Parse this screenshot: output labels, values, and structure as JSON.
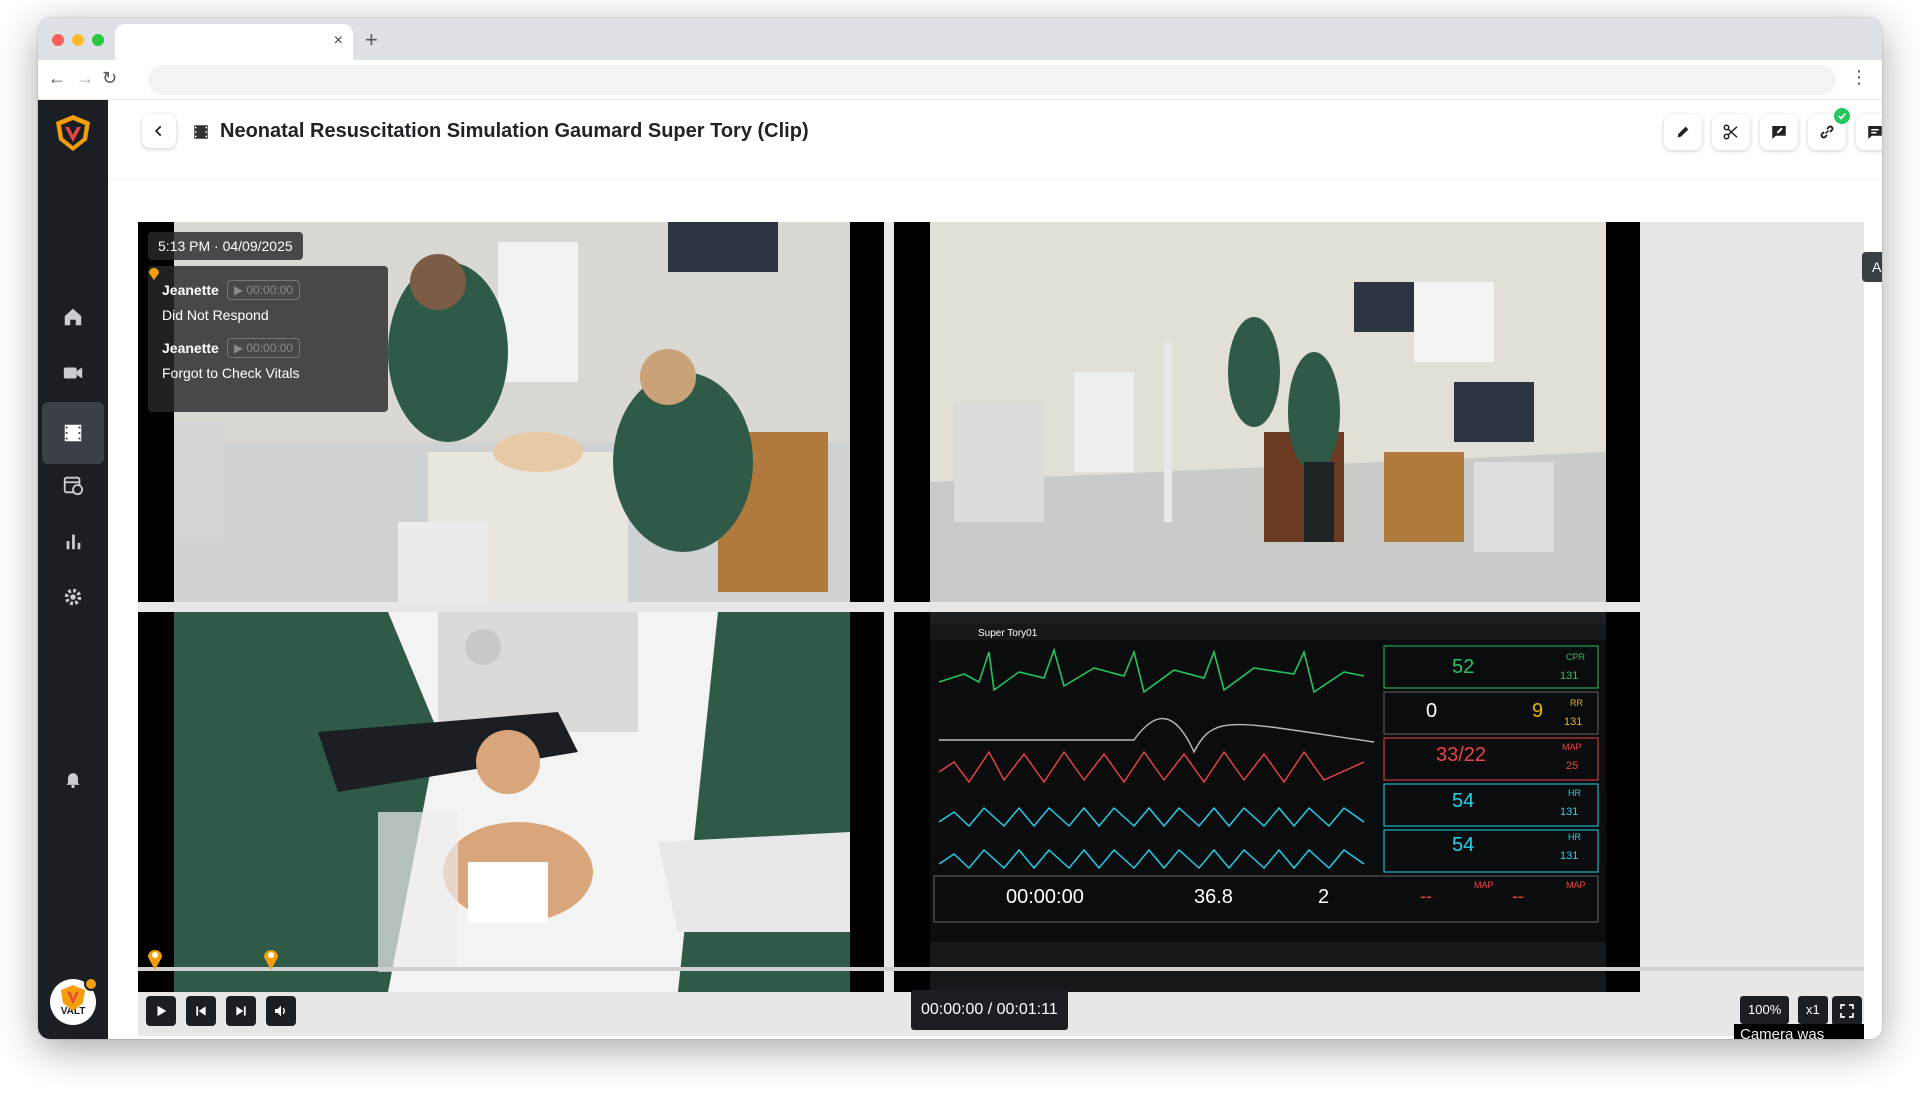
{
  "browser": {
    "tab_title": "",
    "close_glyph": "×",
    "new_tab_glyph": "+",
    "url": ""
  },
  "sidebar": {
    "items": [
      {
        "name": "home-icon"
      },
      {
        "name": "camera-icon"
      },
      {
        "name": "clips-icon",
        "active": true
      },
      {
        "name": "schedule-icon"
      },
      {
        "name": "reports-icon"
      },
      {
        "name": "settings-icon"
      }
    ],
    "avatar_text": "VALT"
  },
  "header": {
    "title": "Neonatal Resuscitation Simulation Gaumard Super Tory (Clip)",
    "actions": [
      "edit-icon",
      "scissors-icon",
      "annotate-icon",
      "link-icon",
      "comment-icon"
    ]
  },
  "overlay": {
    "timestamp": "5:13 PM · 04/09/2025",
    "events": [
      {
        "author": "Jeanette",
        "time": "▶ 00:00:00",
        "label": "Did Not Respond",
        "color": "#3b82f6"
      },
      {
        "author": "Jeanette",
        "time": "▶ 00:00:00",
        "label": "Forgot to Check Vitals",
        "color": "#f59e0b"
      }
    ]
  },
  "view_controls": {
    "video_select": "All videos"
  },
  "monitor": {
    "app_title": "Super Tory01",
    "hr_value": "52",
    "hr_label": "CPR",
    "hr_sub": "131",
    "resp_value": "0",
    "etco2_value": "9",
    "rr_label": "RR",
    "rr_sub": "131",
    "bp_value": "33/22",
    "map_label": "MAP",
    "map_value": "25",
    "spo2_pre": "54",
    "spo2_pre_label": "HR",
    "spo2_pre_sub": "131",
    "spo2_post": "54",
    "spo2_post_label": "HR",
    "spo2_post_sub": "131",
    "scenario_time": "00:00:00",
    "temperature": "36.8",
    "capillary_refill": "2",
    "nibp_1": "--",
    "nibp_1_label": "MAP",
    "nibp_2": "--",
    "nibp_2_label": "MAP"
  },
  "playback": {
    "time_display": "00:00:00 / 00:01:11",
    "zoom": "100%",
    "speed": "x1",
    "camera_status": "Camera was unavailable",
    "progress": 0
  },
  "colors": {
    "accent": "#f59e0b",
    "sidebar_bg": "#1b1f24",
    "monitor_green": "#22c55e",
    "monitor_red": "#ef4444",
    "monitor_cyan": "#22d3ee",
    "monitor_yellow": "#eab308"
  }
}
